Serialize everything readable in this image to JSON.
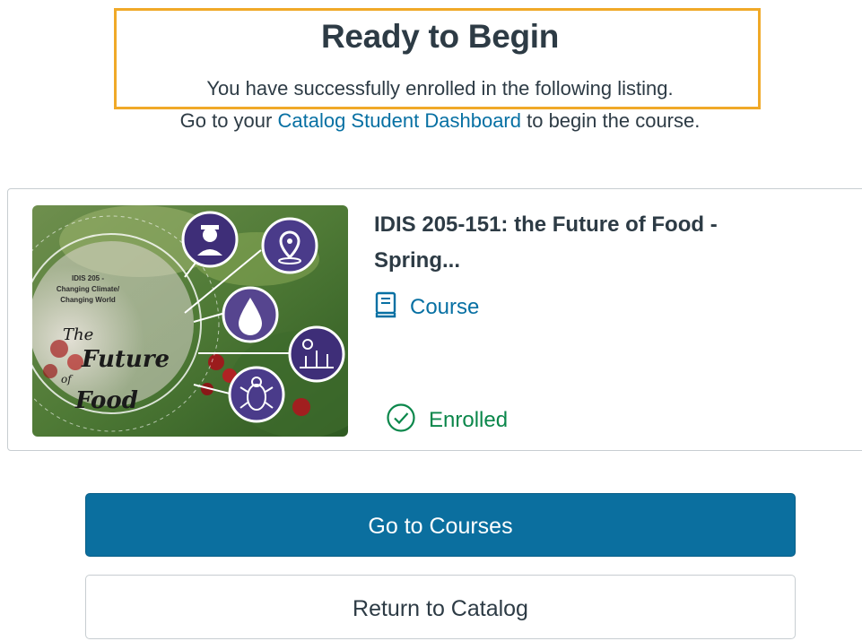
{
  "header": {
    "title": "Ready to Begin",
    "subtitle": "You have successfully enrolled in the following listing.",
    "instruction_prefix": "Go to your ",
    "instruction_link": "Catalog Student Dashboard",
    "instruction_suffix": " to begin the course."
  },
  "listing": {
    "title": "IDIS 205-151: the Future of Food - Spring...",
    "type_icon": "book-icon",
    "type_label": "Course",
    "status_icon": "check-circle-icon",
    "status_label": "Enrolled",
    "image": {
      "caption_line1": "IDIS 205 -",
      "caption_line2": "Changing Climate/",
      "caption_line3": "Changing World",
      "script_the": "The",
      "script_future": "Future",
      "script_of": "of",
      "script_food": "Food",
      "icons": [
        "farmer-icon",
        "location-pin-icon",
        "water-drop-icon",
        "crops-icon",
        "bug-icon"
      ]
    }
  },
  "actions": {
    "primary_label": "Go to Courses",
    "secondary_label": "Return to Catalog"
  },
  "colors": {
    "highlight": "#f0a928",
    "link": "#0770a3",
    "success": "#0b874b",
    "primary_button": "#0b6f9f"
  }
}
